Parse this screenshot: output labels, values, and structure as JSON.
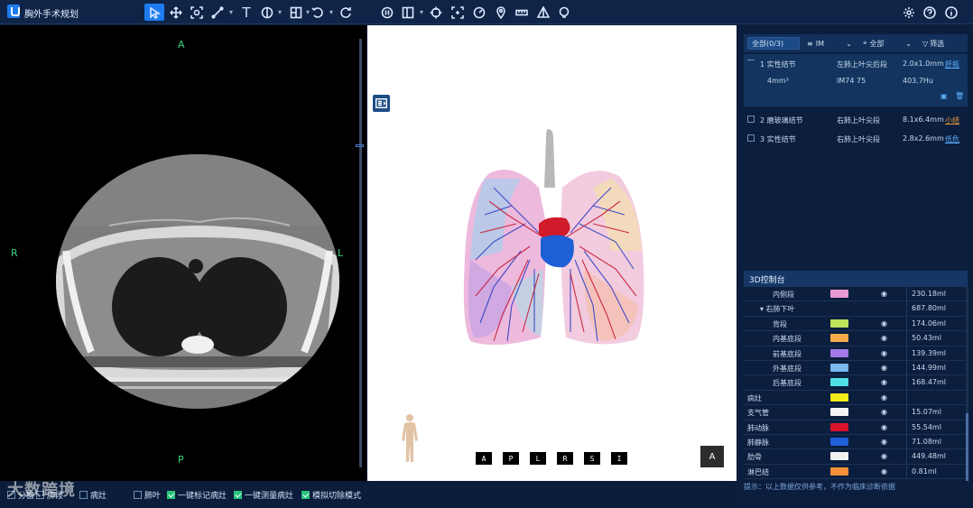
{
  "app": {
    "title": "胸外手术规划"
  },
  "toolbar": {
    "right_icons": [
      "gear-icon",
      "help-icon",
      "info-icon"
    ]
  },
  "viewer2d": {
    "top": "A",
    "bottom": "P",
    "left": "R",
    "right": "L"
  },
  "viewer3d": {
    "view_buttons": [
      "A",
      "P",
      "L",
      "R",
      "S",
      "I"
    ],
    "corner_view": "A"
  },
  "nodules": {
    "filter_all": "全部(0/3)",
    "filter_type": "IM",
    "filter_scope": "全部",
    "filter_label": "筛选",
    "items": [
      {
        "name": "1 实性结节",
        "loc": "左肺上叶尖后段",
        "size": "2.0x1.0mm",
        "status": "肝瓶",
        "volume": "4mm³",
        "density": "IM74 75",
        "hu": "403.7Hu"
      },
      {
        "name": "2 磨玻璃结节",
        "loc": "右肺上叶尖段",
        "size": "8.1x6.4mm",
        "status": "小结"
      },
      {
        "name": "3 实性结节",
        "loc": "右肺上叶尖段",
        "size": "2.8x2.6mm",
        "status": "低危"
      }
    ]
  },
  "control": {
    "title": "3D控制台",
    "rows": [
      {
        "name": "内侧段",
        "color": "#e99ad4",
        "value": "230.18ml",
        "indent": 2
      },
      {
        "name": "▾ 右肺下叶",
        "color": "",
        "value": "687.80ml",
        "indent": 1
      },
      {
        "name": "背段",
        "color": "#bfe35a",
        "value": "174.06ml",
        "indent": 2
      },
      {
        "name": "内基底段",
        "color": "#f6a94a",
        "value": "50.43ml",
        "indent": 2
      },
      {
        "name": "前基底段",
        "color": "#a27ae8",
        "value": "139.39ml",
        "indent": 2
      },
      {
        "name": "外基底段",
        "color": "#7ab8f0",
        "value": "144.99ml",
        "indent": 2
      },
      {
        "name": "后基底段",
        "color": "#4fe0e6",
        "value": "168.47ml",
        "indent": 2
      },
      {
        "name": "病灶",
        "color": "#f2ec1b",
        "value": "",
        "indent": 0
      },
      {
        "name": "支气管",
        "color": "#f4f4f4",
        "value": "15.07ml",
        "indent": 0
      },
      {
        "name": "肺动脉",
        "color": "#d9142b",
        "value": "55.54ml",
        "indent": 0
      },
      {
        "name": "肺静脉",
        "color": "#1f5fd8",
        "value": "71.08ml",
        "indent": 0
      },
      {
        "name": "肋骨",
        "color": "#f1f1f1",
        "value": "449.48ml",
        "indent": 0
      },
      {
        "name": "淋巴结",
        "color": "#f3913a",
        "value": "0.81ml",
        "indent": 0
      }
    ]
  },
  "hint": "提示：以上数据仅供参考，不作为临床诊断依据",
  "bottom": {
    "items": [
      {
        "label": "分窗",
        "checked": false
      },
      {
        "label": "肺段",
        "checked": false
      },
      {
        "label": "病灶",
        "checked": false
      },
      {
        "label": "肺叶",
        "checked": false
      },
      {
        "label": "一键标记病灶",
        "checked": true
      },
      {
        "label": "一键测量病灶",
        "checked": true
      },
      {
        "label": "模拟切除模式",
        "checked": true
      }
    ],
    "watermark": "大数跨境"
  }
}
